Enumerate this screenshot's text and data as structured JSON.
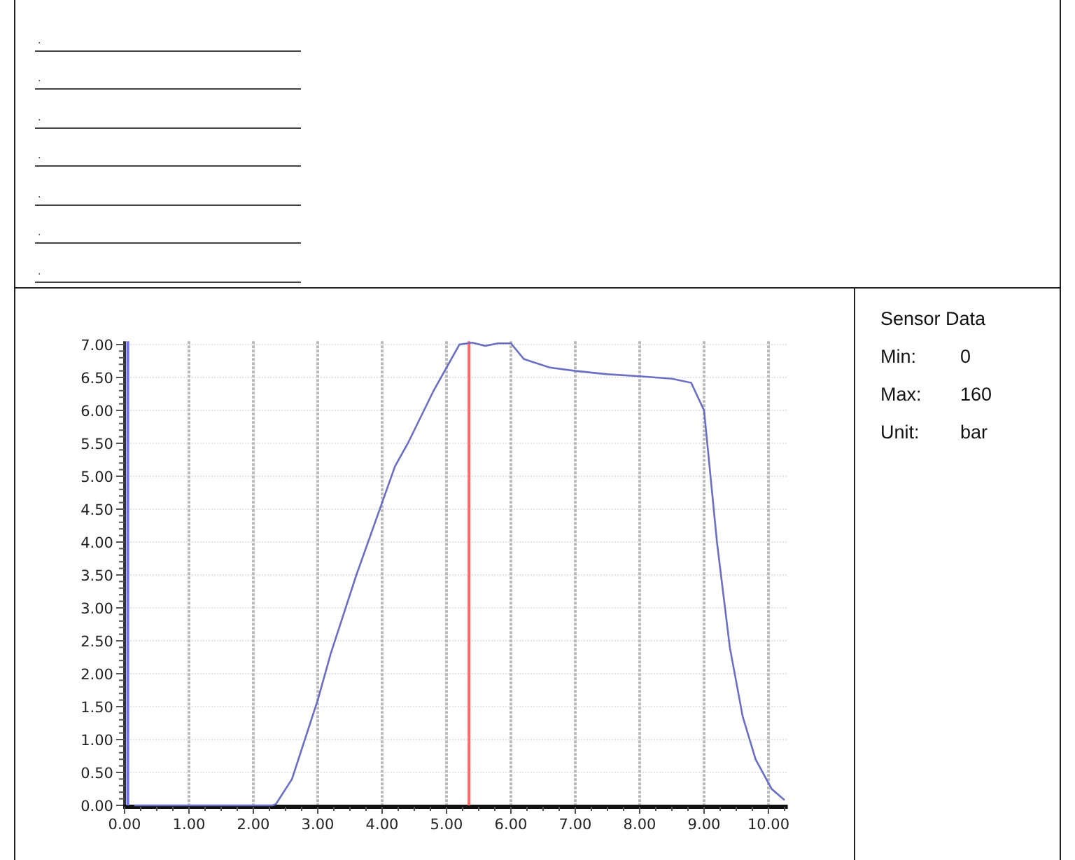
{
  "form_lines": [
    {
      "label": "."
    },
    {
      "label": "."
    },
    {
      "label": "."
    },
    {
      "label": "."
    },
    {
      "label": "."
    },
    {
      "label": "."
    },
    {
      "label": "."
    }
  ],
  "chart": {
    "chart_data": {
      "type": "line",
      "xlim": [
        0,
        10.3
      ],
      "ylim": [
        0,
        7.05
      ],
      "xticks": [
        {
          "value": 0,
          "label": "0.00"
        },
        {
          "value": 1,
          "label": "1.00"
        },
        {
          "value": 2,
          "label": "2.00"
        },
        {
          "value": 3,
          "label": "3.00"
        },
        {
          "value": 4,
          "label": "4.00"
        },
        {
          "value": 5,
          "label": "5.00"
        },
        {
          "value": 6,
          "label": "6.00"
        },
        {
          "value": 7,
          "label": "7.00"
        },
        {
          "value": 8,
          "label": "8.00"
        },
        {
          "value": 9,
          "label": "9.00"
        },
        {
          "value": 10,
          "label": "10.00"
        }
      ],
      "yticks": [
        {
          "value": 0,
          "label": "0.00"
        },
        {
          "value": 0.5,
          "label": "0.50"
        },
        {
          "value": 1,
          "label": "1.00"
        },
        {
          "value": 1.5,
          "label": "1.50"
        },
        {
          "value": 2,
          "label": "2.00"
        },
        {
          "value": 2.5,
          "label": "2.50"
        },
        {
          "value": 3,
          "label": "3.00"
        },
        {
          "value": 3.5,
          "label": "3.50"
        },
        {
          "value": 4,
          "label": "4.00"
        },
        {
          "value": 4.5,
          "label": "4.50"
        },
        {
          "value": 5,
          "label": "5.00"
        },
        {
          "value": 5.5,
          "label": "5.50"
        },
        {
          "value": 6,
          "label": "6.00"
        },
        {
          "value": 6.5,
          "label": "6.50"
        },
        {
          "value": 7,
          "label": "7.00"
        }
      ],
      "x": [
        0.15,
        2.3,
        2.35,
        2.6,
        2.8,
        3.0,
        3.2,
        3.6,
        4.0,
        4.2,
        4.4,
        4.8,
        5.2,
        5.4,
        5.6,
        5.8,
        6.0,
        6.2,
        6.6,
        7.0,
        7.5,
        8.0,
        8.5,
        8.8,
        9.0,
        9.2,
        9.4,
        9.6,
        9.8,
        10.05,
        10.25
      ],
      "series": [
        {
          "color": "#6b6fc4",
          "values": [
            0,
            0,
            0.02,
            0.4,
            1.0,
            1.6,
            2.3,
            3.5,
            4.6,
            5.15,
            5.5,
            6.3,
            7.0,
            7.03,
            6.98,
            7.02,
            7.02,
            6.78,
            6.65,
            6.6,
            6.55,
            6.52,
            6.48,
            6.42,
            6.0,
            4.0,
            2.4,
            1.35,
            0.7,
            0.25,
            0.08
          ]
        }
      ],
      "grid": true,
      "ref_lines": [
        {
          "axis": "x",
          "value": 0.05,
          "color": "#6f6fff"
        },
        {
          "axis": "x",
          "value": 5.35,
          "color": "#ff6666"
        }
      ]
    }
  },
  "sensor_panel": {
    "title": "Sensor Data",
    "rows": [
      {
        "label": "Min:",
        "value": "0"
      },
      {
        "label": "Max:",
        "value": "160"
      },
      {
        "label": "Unit:",
        "value": "bar"
      }
    ]
  }
}
